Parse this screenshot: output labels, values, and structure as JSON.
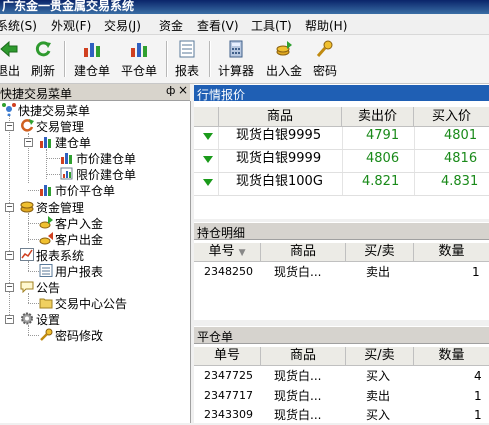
{
  "app": {
    "title": "广东金一贵金属交易系统"
  },
  "menu": [
    "系统(S)",
    "外观(F)",
    "交易(J)",
    "资金",
    "查看(V)",
    "工具(T)",
    "帮助(H)"
  ],
  "toolbar": {
    "exit": "退出",
    "refresh": "刷新",
    "open_order": "建仓单",
    "close_order": "平仓单",
    "report": "报表",
    "calculator": "计算器",
    "deposit": "出入金",
    "password": "密码"
  },
  "left_panel": {
    "title": "快捷交易菜单",
    "pin": "ф",
    "close": "×",
    "tree": {
      "root": "快捷交易菜单",
      "trade_mgmt": "交易管理",
      "open_order": "建仓单",
      "market_open": "市价建仓单",
      "limit_open": "限价建仓单",
      "market_close": "市价平仓单",
      "fund_mgmt": "资金管理",
      "deposit": "客户入金",
      "withdraw": "客户出金",
      "report_sys": "报表系统",
      "user_report": "用户报表",
      "notice": "公告",
      "center_notice": "交易中心公告",
      "settings": "设置",
      "password_change": "密码修改"
    }
  },
  "quote": {
    "title": "行情报价",
    "headers": [
      "商品",
      "卖出价",
      "买入价"
    ],
    "rows": [
      {
        "name": "现货白银9995",
        "sell": "4791",
        "buy": "4801"
      },
      {
        "name": "现货白银9999",
        "sell": "4806",
        "buy": "4816"
      },
      {
        "name": "现货白银100G",
        "sell": "4.821",
        "buy": "4.831"
      }
    ]
  },
  "positions": {
    "title": "持仓明细",
    "headers": [
      "单号",
      "商品",
      "买/卖",
      "数量"
    ],
    "rows": [
      {
        "id": "2348250",
        "name": "现货白...",
        "side": "卖出",
        "qty": "1"
      }
    ]
  },
  "closed": {
    "title": "平仓单",
    "headers": [
      "单号",
      "商品",
      "买/卖",
      "数量"
    ],
    "rows": [
      {
        "id": "2347725",
        "name": "现货白...",
        "side": "买入",
        "qty": "4"
      },
      {
        "id": "2347717",
        "name": "现货白...",
        "side": "卖出",
        "qty": "1"
      },
      {
        "id": "2343309",
        "name": "现货白...",
        "side": "买入",
        "qty": "1"
      }
    ]
  },
  "colors": {
    "price_green": "#1a8a1a",
    "panel_title_blue": "#1f5fb4",
    "down_arrow_green": "#1a9a1a"
  }
}
